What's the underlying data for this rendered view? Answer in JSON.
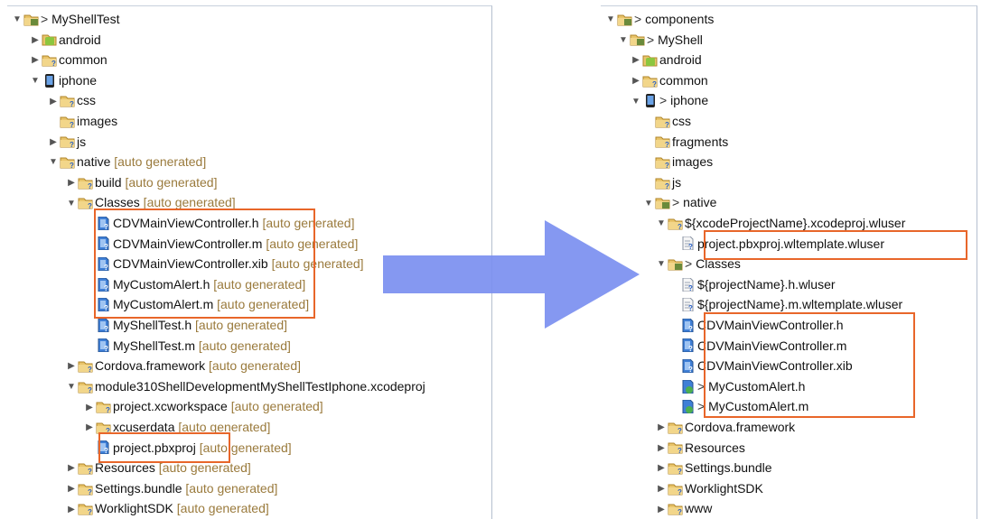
{
  "left_tree": {
    "auto_label": "[auto generated]",
    "items": [
      {
        "label": "MyShellTest",
        "prefix": ">"
      },
      {
        "label": "android"
      },
      {
        "label": "common"
      },
      {
        "label": "iphone"
      },
      {
        "label": "css"
      },
      {
        "label": "images"
      },
      {
        "label": "js"
      },
      {
        "label": "native"
      },
      {
        "label": "build"
      },
      {
        "label": "Classes"
      },
      {
        "label": "CDVMainViewController.h"
      },
      {
        "label": "CDVMainViewController.m"
      },
      {
        "label": "CDVMainViewController.xib"
      },
      {
        "label": "MyCustomAlert.h"
      },
      {
        "label": "MyCustomAlert.m"
      },
      {
        "label": "MyShellTest.h"
      },
      {
        "label": "MyShellTest.m"
      },
      {
        "label": "Cordova.framework"
      },
      {
        "label": "module310ShellDevelopmentMyShellTestIphone.xcodeproj"
      },
      {
        "label": "project.xcworkspace"
      },
      {
        "label": "xcuserdata"
      },
      {
        "label": "project.pbxproj"
      },
      {
        "label": "Resources"
      },
      {
        "label": "Settings.bundle"
      },
      {
        "label": "WorklightSDK"
      }
    ]
  },
  "right_tree": {
    "items": [
      {
        "label": "components",
        "prefix": ">"
      },
      {
        "label": "MyShell",
        "prefix": ">"
      },
      {
        "label": "android"
      },
      {
        "label": "common"
      },
      {
        "label": "iphone",
        "prefix": ">"
      },
      {
        "label": "css"
      },
      {
        "label": "fragments"
      },
      {
        "label": "images"
      },
      {
        "label": "js"
      },
      {
        "label": "native",
        "prefix": ">"
      },
      {
        "label": "${xcodeProjectName}.xcodeproj.wluser"
      },
      {
        "label": "project.pbxproj.wltemplate.wluser"
      },
      {
        "label": "Classes",
        "prefix": ">"
      },
      {
        "label": "${projectName}.h.wluser"
      },
      {
        "label": "${projectName}.m.wltemplate.wluser"
      },
      {
        "label": "CDVMainViewController.h"
      },
      {
        "label": "CDVMainViewController.m"
      },
      {
        "label": "CDVMainViewController.xib"
      },
      {
        "label": "MyCustomAlert.h",
        "prefix": ">"
      },
      {
        "label": "MyCustomAlert.m",
        "prefix": ">"
      },
      {
        "label": "Cordova.framework"
      },
      {
        "label": "Resources"
      },
      {
        "label": "Settings.bundle"
      },
      {
        "label": "WorklightSDK"
      },
      {
        "label": "www"
      }
    ]
  },
  "colors": {
    "highlight": "#e8662a",
    "arrow": "#7b8ff0",
    "auto_text": "#9a7a3c"
  }
}
